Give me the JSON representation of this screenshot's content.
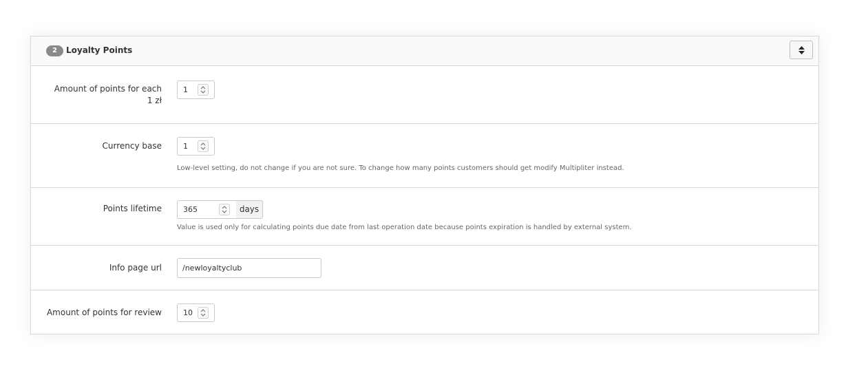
{
  "section": {
    "step_number": "2",
    "title": "Loyalty Points"
  },
  "fields": {
    "points_per_currency": {
      "label": "Amount of points for each 1 zł",
      "value": "1"
    },
    "currency_base": {
      "label": "Currency base",
      "value": "1",
      "help": "Low-level setting, do not change if you are not sure. To change how many points customers should get modify Multipliter instead."
    },
    "points_lifetime": {
      "label": "Points lifetime",
      "value": "365",
      "unit": "days",
      "help": "Value is used only for calculating points due date from last operation date because points expiration is handled by external system."
    },
    "info_page_url": {
      "label": "Info page url",
      "value": "/newloyaltyclub"
    },
    "points_for_review": {
      "label": "Amount of points for review",
      "value": "10"
    }
  },
  "icons": {
    "toggle": "sort-icon",
    "spinner": "spinner-arrows-icon"
  }
}
